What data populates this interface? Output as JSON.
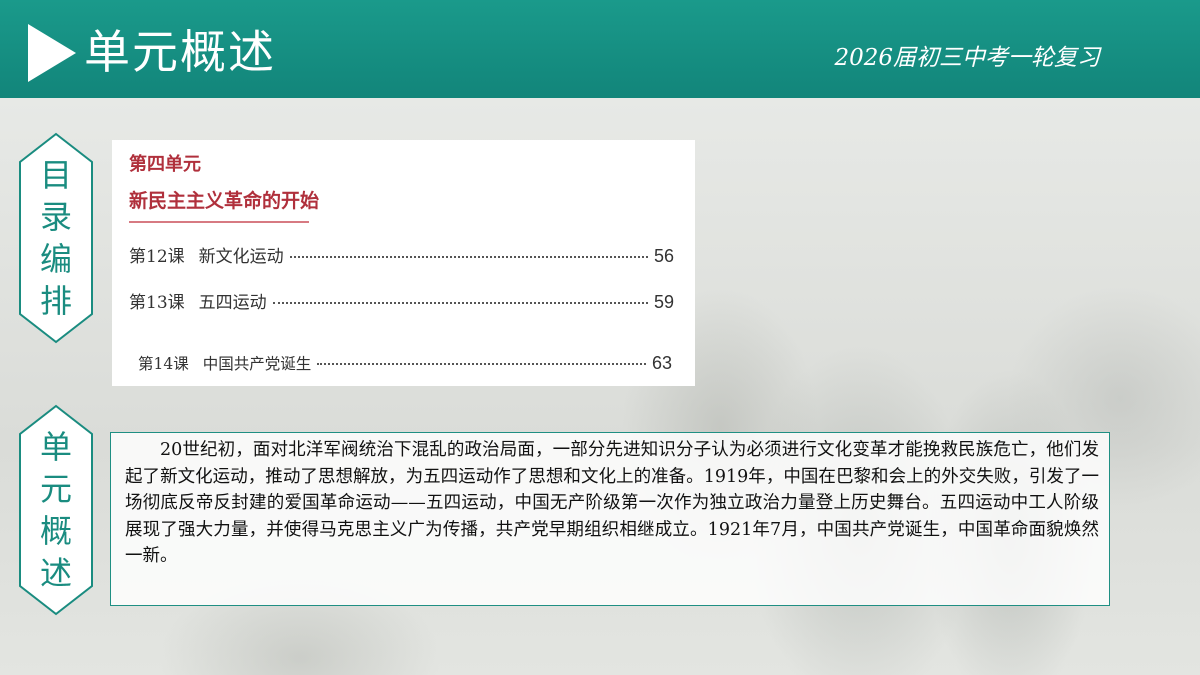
{
  "header": {
    "title": "单元概述",
    "subtitle": "2026届初三中考一轮复习"
  },
  "side_labels": {
    "toc": "目录编排",
    "summary": "单元概述"
  },
  "toc": {
    "unit_label": "第四单元",
    "unit_title": "新民主主义革命的开始",
    "lessons": [
      {
        "number": "第12课",
        "name": "新文化运动",
        "page": "56"
      },
      {
        "number": "第13课",
        "name": "五四运动",
        "page": "59"
      },
      {
        "number": "第14课",
        "name": "中国共产党诞生",
        "page": "63"
      }
    ]
  },
  "summary": {
    "text": "20世纪初，面对北洋军阀统治下混乱的政治局面，一部分先进知识分子认为必须进行文化变革才能挽救民族危亡，他们发起了新文化运动，推动了思想解放，为五四运动作了思想和文化上的准备。1919年，中国在巴黎和会上的外交失败，引发了一场彻底反帝反封建的爱国革命运动——五四运动，中国无产阶级第一次作为独立政治力量登上历史舞台。五四运动中工人阶级展现了强大力量，并使得马克思主义广为传播，共产党早期组织相继成立。1921年7月，中国共产党诞生，中国革命面貌焕然一新。"
  },
  "colors": {
    "header": "#12857a",
    "accent": "#1a8c80",
    "toc_red": "#b0303c"
  },
  "icons": {
    "header_arrow": "play-arrow-icon",
    "side_frames": "hexagon-frame-icon"
  }
}
